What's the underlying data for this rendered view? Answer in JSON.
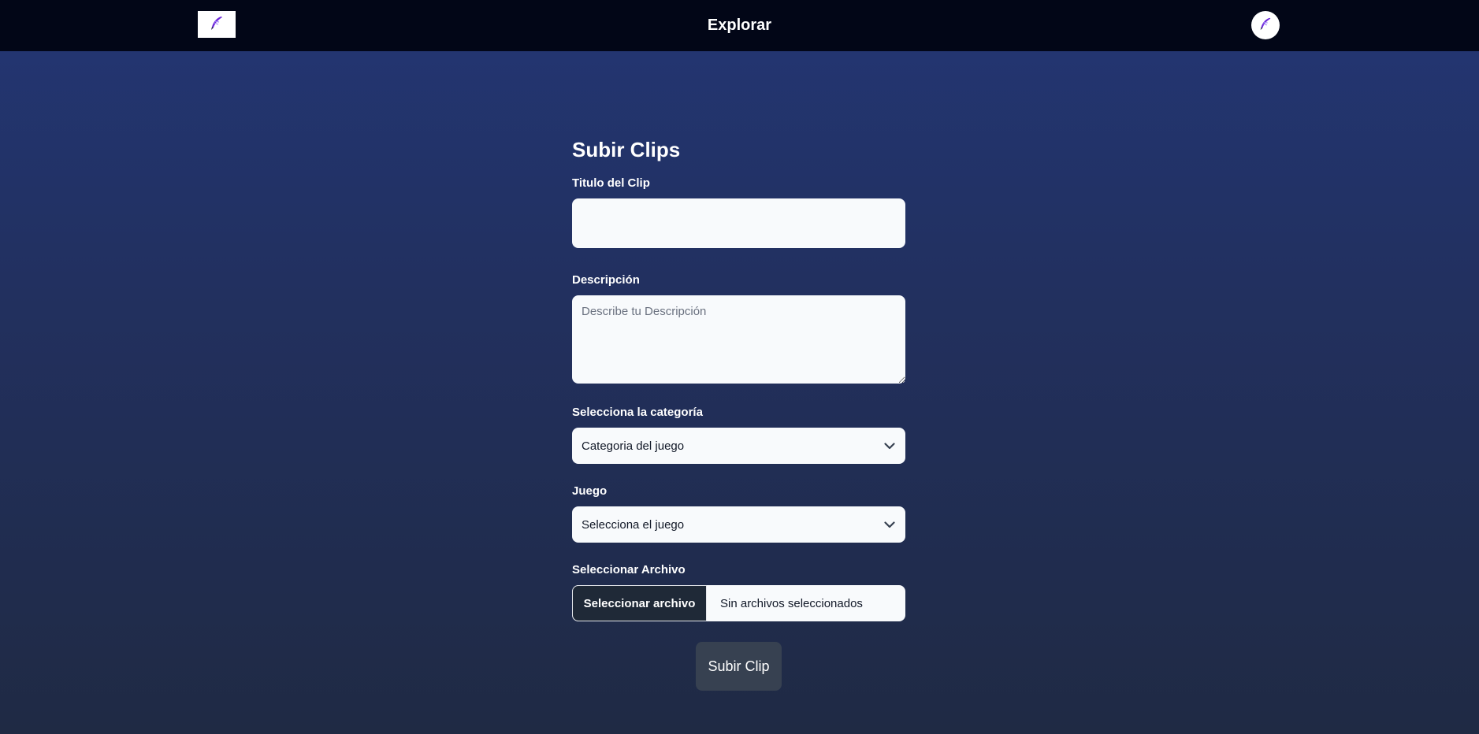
{
  "nav": {
    "title": "Explorar",
    "logo_icon": "feather-pen-icon",
    "avatar_icon": "feather-pen-icon"
  },
  "form": {
    "heading": "Subir Clips",
    "title_label": "Titulo del Clip",
    "title_value": "",
    "description_label": "Descripción",
    "description_placeholder": "Describe tu Descripción",
    "category_label": "Selecciona la categoría",
    "category_value": "Categoria del juego",
    "game_label": "Juego",
    "game_value": "Selecciona el juego",
    "file_label": "Seleccionar Archivo",
    "file_button": "Seleccionar archivo",
    "file_status": "Sin archivos seleccionados",
    "submit_label": "Subir Clip"
  },
  "colors": {
    "navbar": "#020617",
    "background_top": "#233674",
    "background_bottom": "#1f2a44",
    "input_bg": "#f8fafc",
    "submit_bg": "#374151",
    "file_button_bg": "#1f2937"
  }
}
